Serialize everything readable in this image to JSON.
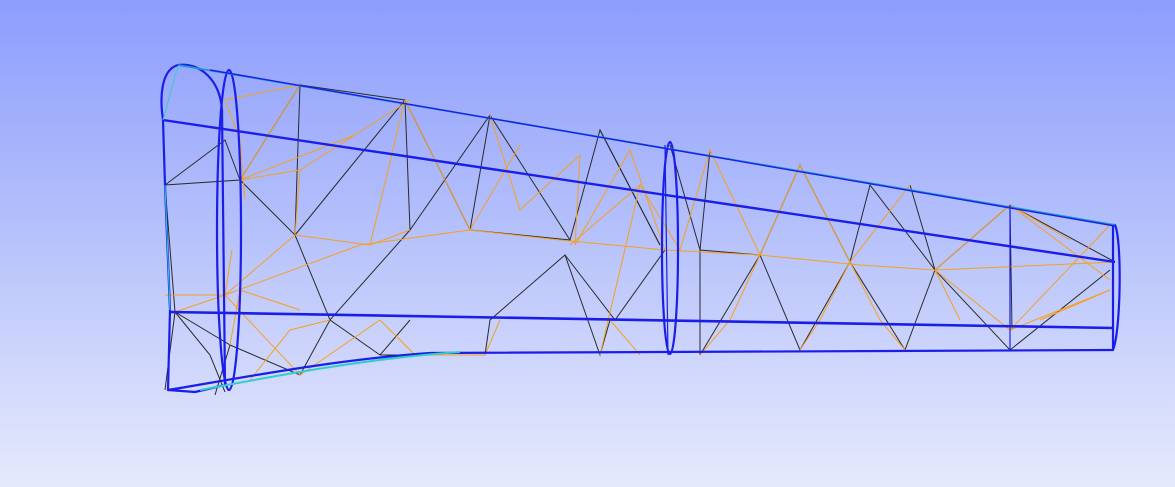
{
  "viewer": {
    "background_top": "#8d9dfc",
    "background_bottom": "#e6eafc"
  },
  "colors": {
    "outline": "#1a1ee8",
    "leading_edge": "#1a9ad0",
    "mesh_black": "#2a2a2a",
    "mesh_orange": "#f5a020",
    "trailing_fill": "#33cccc"
  }
}
